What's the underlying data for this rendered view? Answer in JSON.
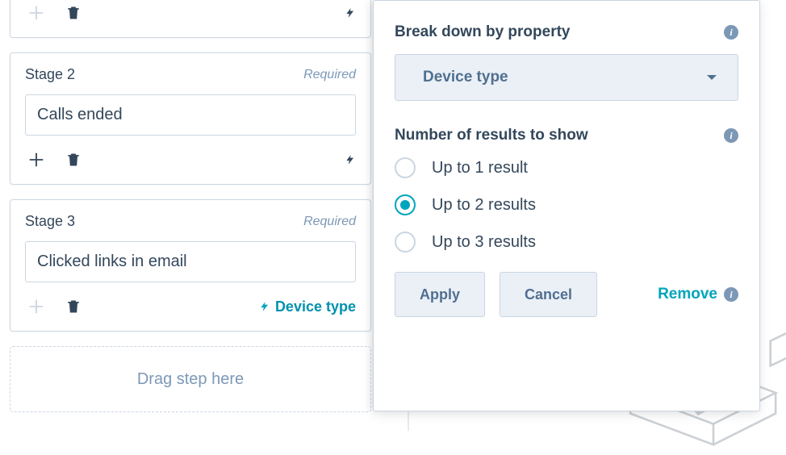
{
  "stages": [
    {
      "name_label": "Stage 2",
      "required_label": "Required",
      "value": "Calls ended",
      "has_breakdown": false
    },
    {
      "name_label": "Stage 3",
      "required_label": "Required",
      "value": "Clicked links in email",
      "has_breakdown": true,
      "breakdown_label": "Device type"
    }
  ],
  "drop_zone": "Drag step here",
  "panel": {
    "breakdown_label": "Break down by property",
    "dropdown_selected": "Device type",
    "results_label": "Number of results to show",
    "radio_options": [
      "Up to 1 result",
      "Up to 2 results",
      "Up to 3 results"
    ],
    "selected_index": 1,
    "apply_label": "Apply",
    "cancel_label": "Cancel",
    "remove_label": "Remove"
  }
}
